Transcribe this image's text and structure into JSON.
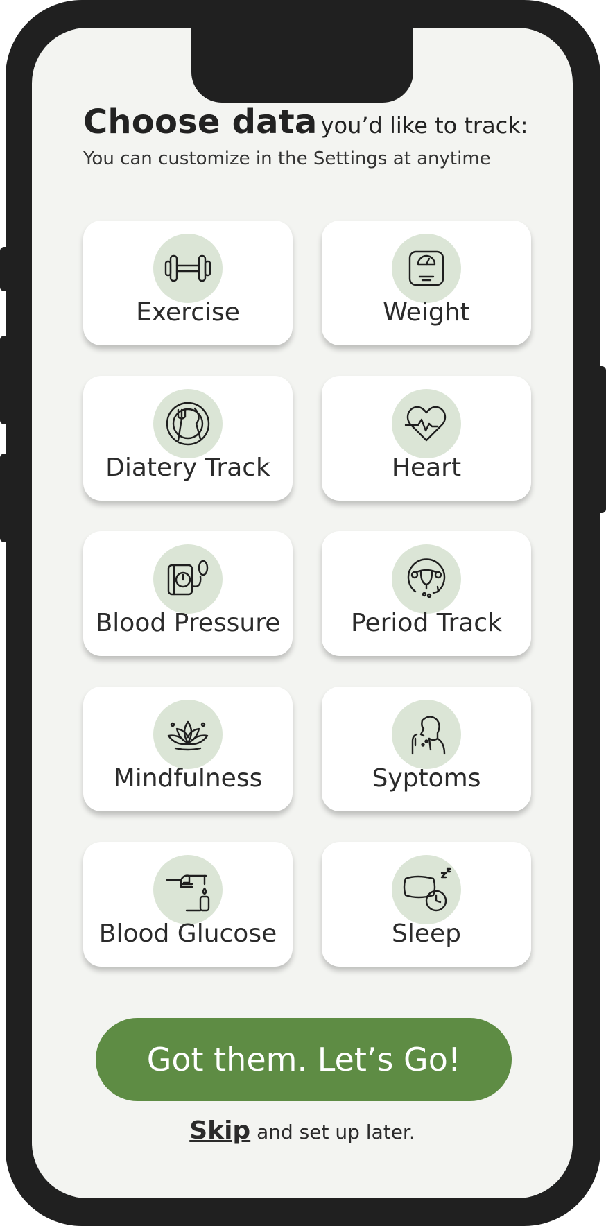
{
  "header": {
    "title_strong": "Choose data",
    "title_rest": "you’d like to track:",
    "subtitle": "You can customize in the Settings at anytime"
  },
  "options": [
    {
      "label": "Exercise",
      "icon": "dumbbell-icon"
    },
    {
      "label": "Weight",
      "icon": "scale-icon"
    },
    {
      "label": "Diatery Track",
      "icon": "plate-fork-knife-icon"
    },
    {
      "label": "Heart",
      "icon": "heartbeat-icon"
    },
    {
      "label": "Blood Pressure",
      "icon": "blood-pressure-monitor-icon"
    },
    {
      "label": "Period Track",
      "icon": "uterus-icon"
    },
    {
      "label": "Mindfulness",
      "icon": "lotus-icon"
    },
    {
      "label": "Syptoms",
      "icon": "sick-person-icon"
    },
    {
      "label": "Blood Glucose",
      "icon": "glucose-meter-icon"
    },
    {
      "label": "Sleep",
      "icon": "pillow-clock-icon"
    }
  ],
  "cta": {
    "label": "Got them. Let’s Go!"
  },
  "skip": {
    "link": "Skip",
    "rest": "and set up later."
  },
  "colors": {
    "accent": "#5e8c44",
    "icon_bg": "#dbe5d6",
    "screen_bg": "#f3f4f1",
    "frame": "#202020"
  }
}
